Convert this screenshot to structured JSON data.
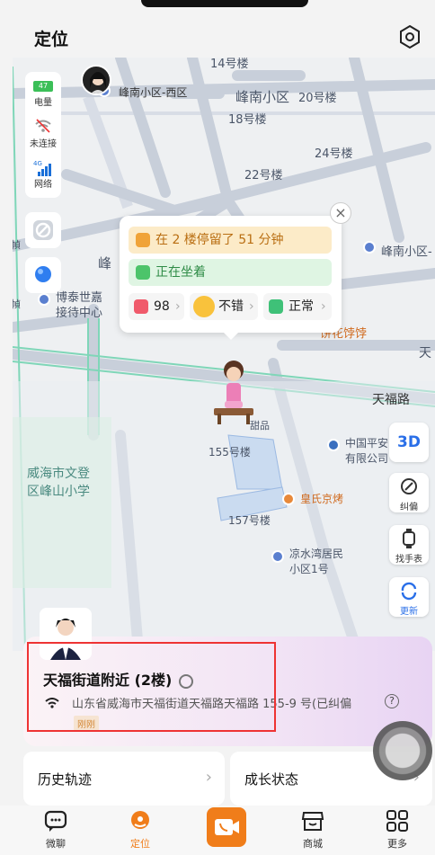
{
  "header": {
    "title": "定位"
  },
  "map": {
    "labels": {
      "b14": "14号楼",
      "fengnan_west": "峰南小区-西区",
      "fengnan": "峰南小区",
      "b20": "20号楼",
      "b18": "18号楼",
      "b24": "24号楼",
      "b22": "22号楼",
      "fengnan_right": "峰南小区-",
      "feng_left": "峰",
      "hui": "幀",
      "hui2": "幀",
      "botai1": "博泰世嘉",
      "botai2": "接待中心",
      "bing": "饼花饽饽",
      "tian_right": "天",
      "tianfu_road": "天福路",
      "zhongguo1": "中国平安",
      "zhongguo2": "有限公司",
      "b155": "155号楼",
      "weihai1": "威海市文登",
      "weihai2": "区峰山小学",
      "huangshi": "皇氏京烤",
      "b157": "157号楼",
      "liangshui1": "凉水湾居民",
      "liangshui2": "小区1号",
      "tianpin": "甜品"
    }
  },
  "device": {
    "battery": "47",
    "battery_label": "电量",
    "wifi_label": "未连接",
    "network_tag": "4G",
    "network_label": "网络"
  },
  "popup": {
    "stay": "在 2 楼停留了 51 分钟",
    "status": "正在坐着",
    "heart": "98",
    "mood": "不错",
    "temp": "正常"
  },
  "right_buttons": {
    "three_d": "3D",
    "correct": "纠偏",
    "find_watch": "找手表",
    "refresh": "更新"
  },
  "location_card": {
    "title": "天福街道附近 (2楼)",
    "address": "山东省威海市天福街道天福路天福路 155-9 号(已纠偏",
    "time_tag": "刚刚"
  },
  "bottom_cards": {
    "history": "历史轨迹",
    "growth": "成长状态"
  },
  "tabs": {
    "chat": "微聊",
    "locate": "定位",
    "mall": "商城",
    "more": "更多"
  },
  "colors": {
    "accent_orange": "#f07d1a",
    "road_green": "#7fd6b8",
    "popup_yellow": "#fcebc8",
    "popup_green": "#dff5e3",
    "highlight_red": "#e33333",
    "blue_3d": "#2a6fe8"
  }
}
